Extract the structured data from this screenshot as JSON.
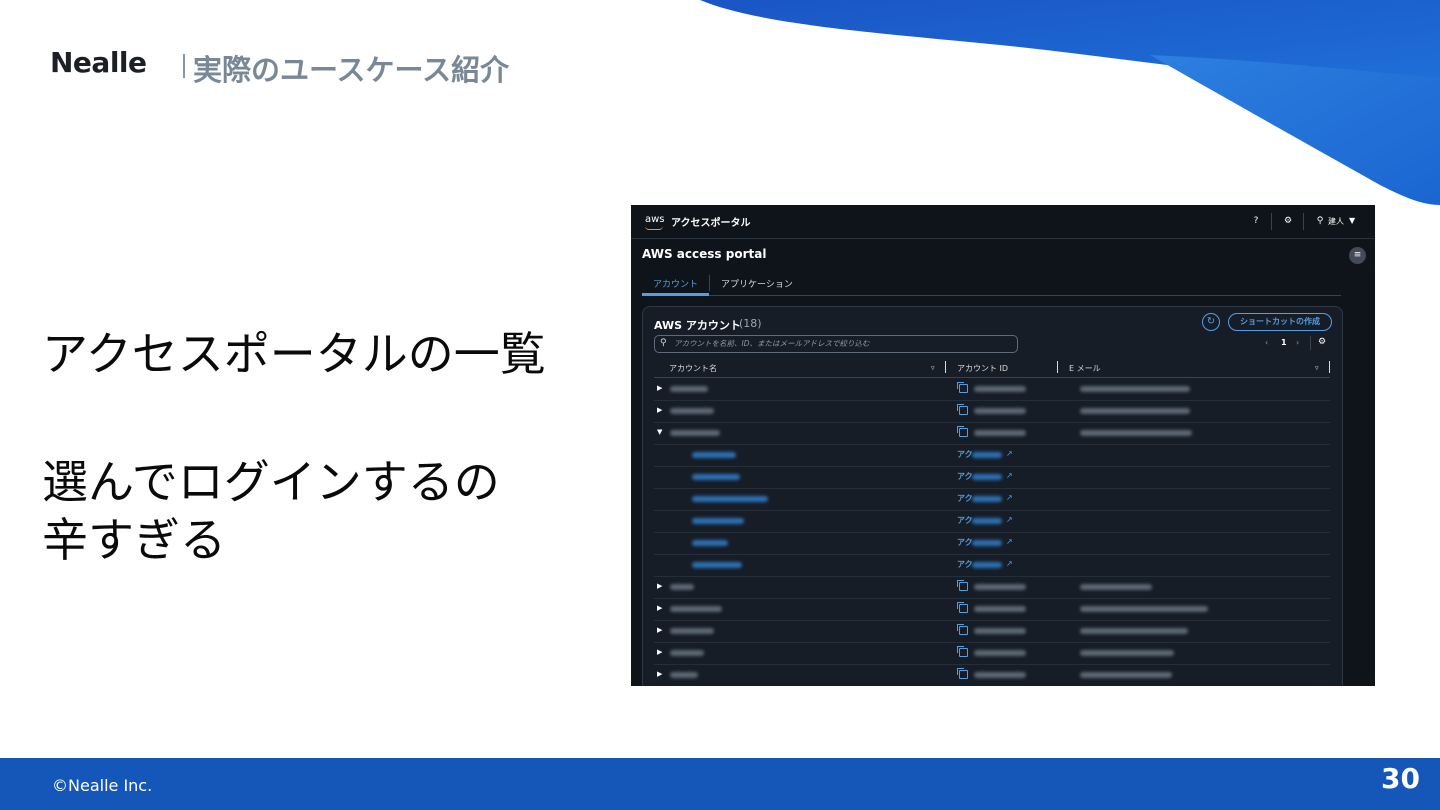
{
  "slide": {
    "brand": "Nealle",
    "section_title": "実際のユースケース紹介",
    "point_1": "アクセスポータルの一覧",
    "point_2_line1": "選んでログインするの",
    "point_2_line2": "辛すぎる",
    "copyright": "©Nealle Inc.",
    "page_number": "30",
    "colors": {
      "accent_blue": "#1557b8",
      "section_grey": "#7a8896"
    }
  },
  "portal": {
    "logo_text": "aws",
    "header_title": "アクセスポータル",
    "user_name": "建人",
    "page_title": "AWS access portal",
    "tabs": [
      {
        "label": "アカウント",
        "active": true
      },
      {
        "label": "アプリケーション",
        "active": false
      }
    ],
    "accounts_panel": {
      "title": "AWS アカウント",
      "count": "(18)",
      "shortcut_button": "ショートカットの作成",
      "search_placeholder": "アカウントを名前、ID、またはメールアドレスで絞り込む",
      "pager": {
        "prev": "‹",
        "current": "1",
        "next": "›"
      },
      "columns": {
        "name": "アカウント名",
        "id": "アカウント ID",
        "email": "E メール"
      },
      "role_prefix": "アク",
      "rows": [
        {
          "expanded": false,
          "type": "account"
        },
        {
          "expanded": false,
          "type": "account"
        },
        {
          "expanded": true,
          "type": "account"
        },
        {
          "type": "role"
        },
        {
          "type": "role"
        },
        {
          "type": "role"
        },
        {
          "type": "role"
        },
        {
          "type": "role"
        },
        {
          "type": "role"
        },
        {
          "expanded": false,
          "type": "account"
        },
        {
          "expanded": false,
          "type": "account"
        },
        {
          "expanded": false,
          "type": "account"
        },
        {
          "expanded": false,
          "type": "account"
        },
        {
          "expanded": false,
          "type": "account"
        }
      ]
    },
    "icons": [
      "help-icon",
      "gear-icon",
      "user-icon",
      "menu-icon",
      "refresh-icon",
      "search-icon",
      "copy-icon",
      "external-link-icon"
    ]
  }
}
